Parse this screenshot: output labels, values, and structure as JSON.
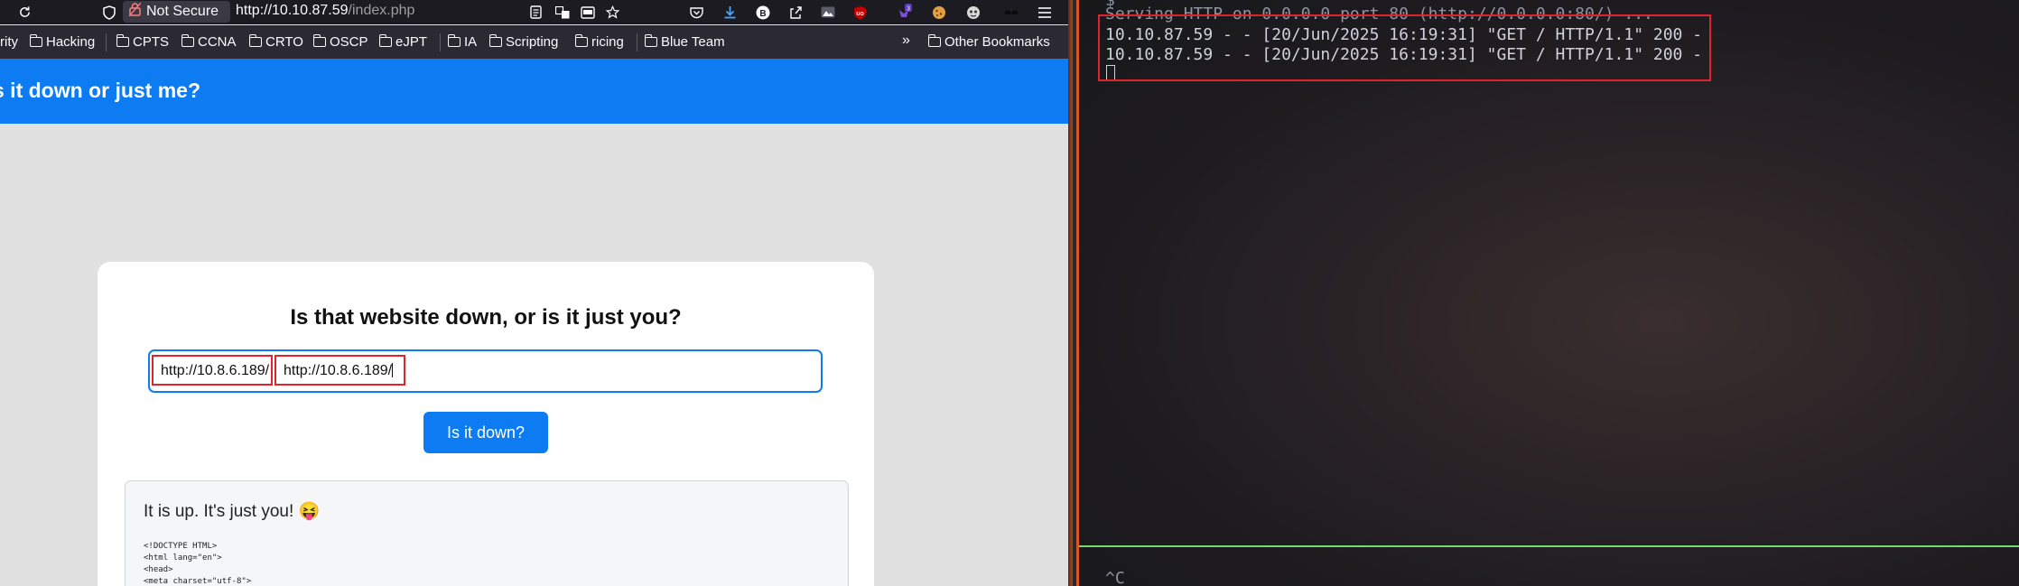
{
  "browser": {
    "toolbar": {
      "security_label": "Not Secure",
      "url_host": "http://10.10.87.59",
      "url_path": "/index.php"
    },
    "bookmarks": [
      "rity",
      "Hacking",
      "CPTS",
      "CCNA",
      "CRTO",
      "OSCP",
      "eJPT",
      "IA",
      "Scripting",
      "ricing",
      "Blue Team"
    ],
    "other_bookmarks": "Other Bookmarks",
    "overflow_icon": "chevron-double-right-icon"
  },
  "page": {
    "header_title": "s it down or just me?",
    "card_title": "Is that website down, or is it just you?",
    "input_value_1": "http://10.8.6.189/",
    "input_value_2": "http://10.8.6.189/",
    "submit_label": "Is it down?",
    "result_message": "It is up. It's just you! 😝",
    "result_code": [
      "<!DOCTYPE HTML>",
      "<html lang=\"en\">",
      "<head>",
      "<meta charset=\"utf-8\">"
    ]
  },
  "terminal": {
    "line_partial_top": "$ ",
    "line_serving": "Serving HTTP on 0.0.0.0 port 80 (http://0.0.0.0:80/) ...",
    "log_1": "10.10.87.59 - - [20/Jun/2025 16:19:31] \"GET / HTTP/1.1\" 200 -",
    "log_2": "10.10.87.59 - - [20/Jun/2025 16:19:31] \"GET / HTTP/1.1\" 200 -",
    "bottom_text": "^C"
  },
  "colors": {
    "accent_blue": "#0d7cf2",
    "highlight_red": "#e0242b",
    "terminal_green": "#6fdc6f"
  }
}
